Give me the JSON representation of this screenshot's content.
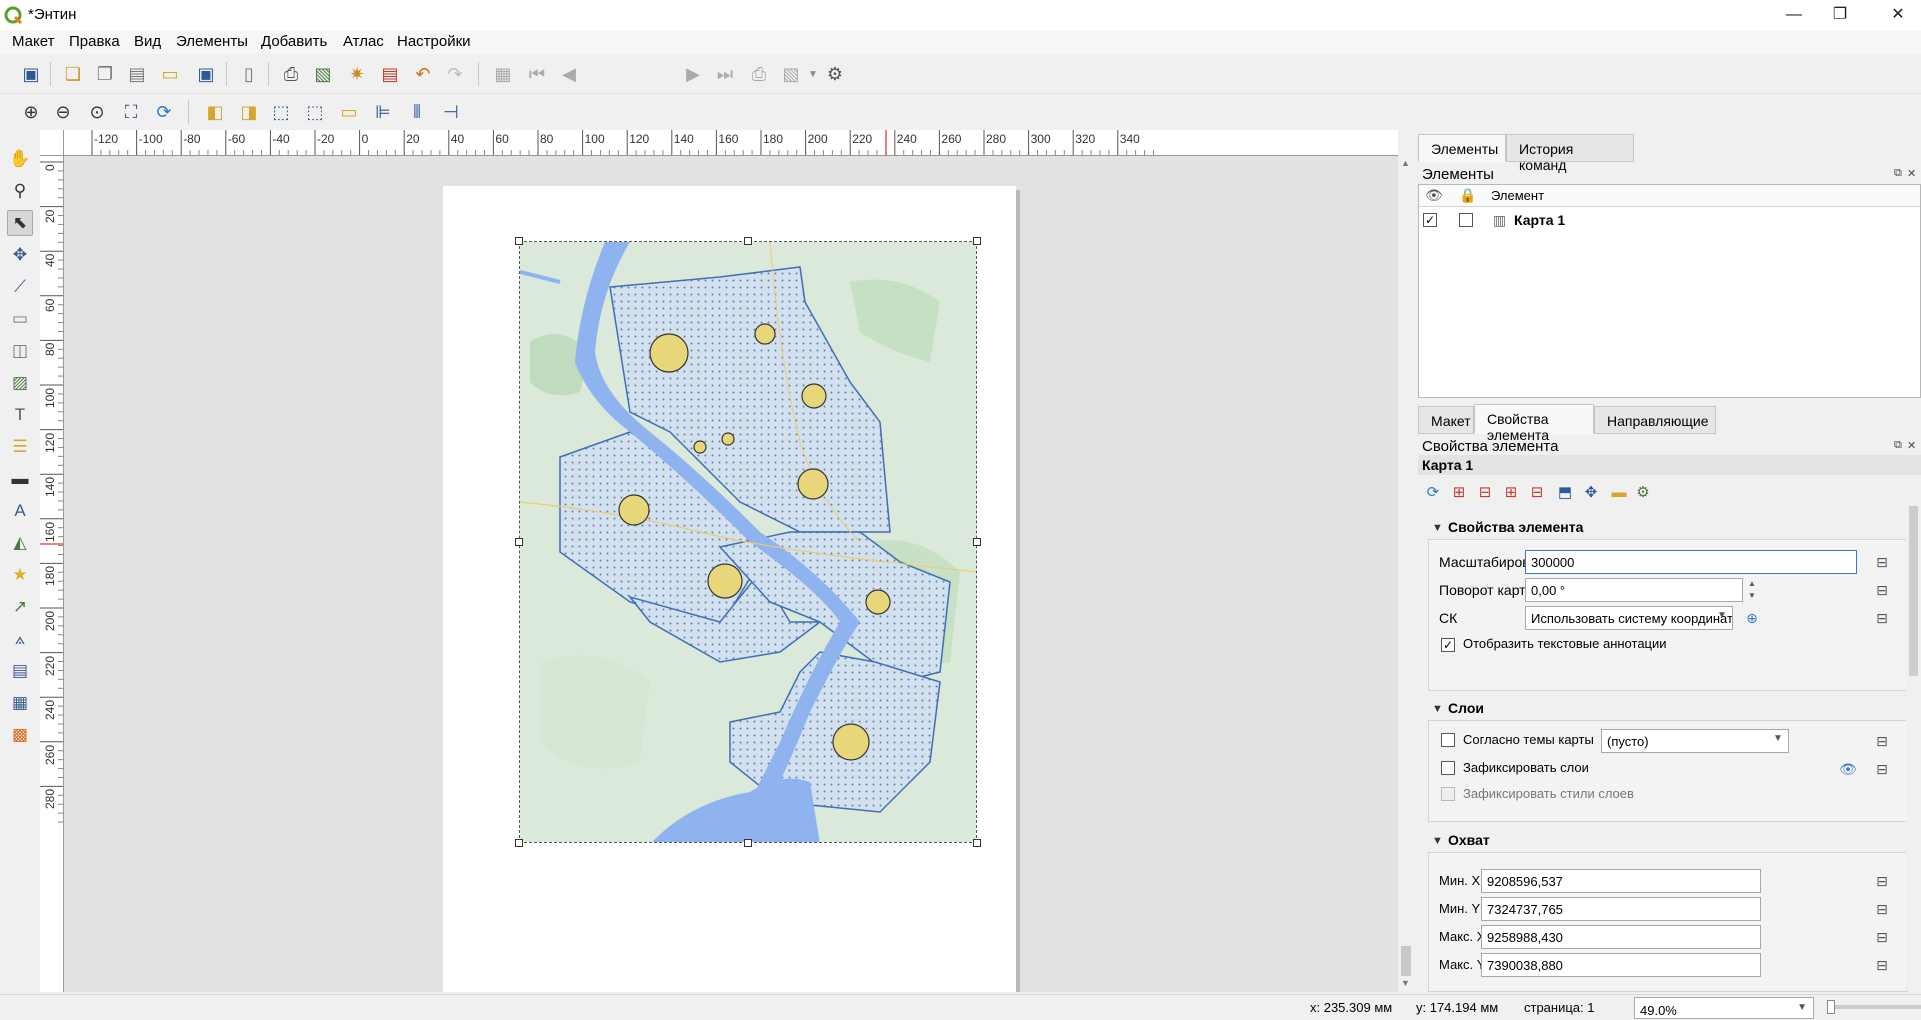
{
  "window": {
    "title": "*Энтин",
    "minimize": "—",
    "restore": "❐",
    "close": "✕"
  },
  "menu": [
    "Макет",
    "Правка",
    "Вид",
    "Элементы",
    "Добавить",
    "Атлас",
    "Настройки"
  ],
  "toolbar": {
    "page_value": "1"
  },
  "ruler": {
    "h_ticks": [
      "-120",
      "-100",
      "-80",
      "-60",
      "-40",
      "-20",
      "0",
      "20",
      "40",
      "60",
      "80",
      "100",
      "120",
      "140",
      "160",
      "180",
      "200",
      "220",
      "240",
      "260",
      "280",
      "300",
      "320",
      "340"
    ],
    "v_ticks": [
      "0",
      "20",
      "40",
      "60",
      "80",
      "100",
      "120",
      "140",
      "160",
      "180",
      "200",
      "220",
      "240",
      "260",
      "280"
    ]
  },
  "dock": {
    "top_tabs": [
      "Элементы",
      "История команд"
    ],
    "items_panel_title": "Элементы",
    "items_header_element": "Элемент",
    "items": [
      {
        "name": "Карта 1",
        "visible": true,
        "locked": false
      }
    ],
    "bottom_tabs": [
      "Макет",
      "Свойства элемента",
      "Направляющие"
    ],
    "props_panel_title": "Свойства элемента",
    "selected_item": "Карта 1",
    "section_main": "Свойства элемента",
    "scale_label": "Масштабировать",
    "scale_value": "300000",
    "rotation_label": "Поворот карты",
    "rotation_value": "0,00 °",
    "crs_label": "СК",
    "crs_value": "Использовать систему координат проекта",
    "show_annotations_label": "Отобразить текстовые аннотации",
    "section_layers": "Слои",
    "follow_theme_label": "Согласно темы карты",
    "follow_theme_value": "(пусто)",
    "lock_layers_label": "Зафиксировать слои",
    "lock_styles_label": "Зафиксировать стили слоев",
    "section_extent": "Охват",
    "min_x_label": "Мин. X",
    "min_x_value": "9208596,537",
    "min_y_label": "Мин. Y",
    "min_y_value": "7324737,765",
    "max_x_label": "Макс. X",
    "max_x_value": "9258988,430",
    "max_y_label": "Макс. Y",
    "max_y_value": "7390038,880"
  },
  "status": {
    "x": "x: 235.309 мм",
    "y": "y: 174.194 мм",
    "page": "страница: 1",
    "zoom": "49.0%"
  },
  "colors": {
    "water": "#8fb3ee",
    "land": "#d9e9d8",
    "district_fill": "#c8d8ec",
    "district_stroke": "#3f6fb6",
    "symbol_fill": "#e8d77a",
    "accent": "#3b79c4"
  }
}
